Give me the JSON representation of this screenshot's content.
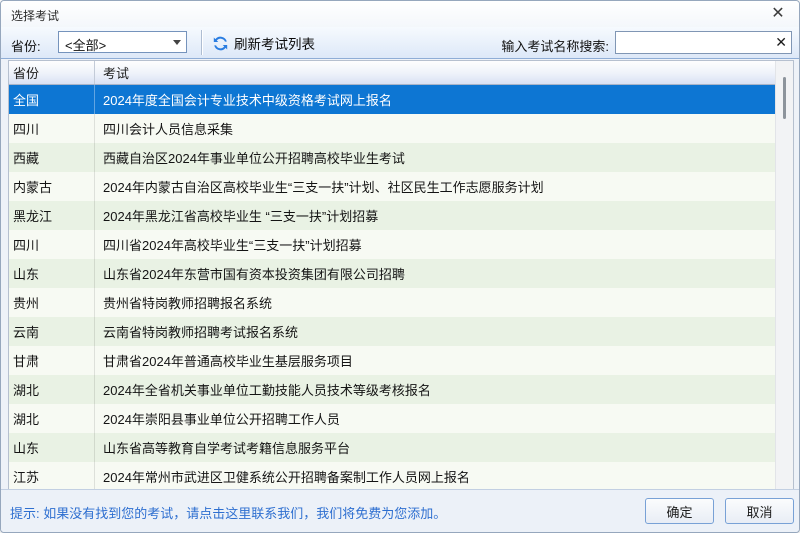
{
  "window": {
    "title": "选择考试",
    "close_glyph": "✕"
  },
  "toolbar": {
    "province_label": "省份:",
    "province_value": "<全部>",
    "refresh_label": "刷新考试列表",
    "search_label": "输入考试名称搜索:",
    "search_value": "",
    "clear_glyph": "✕"
  },
  "table": {
    "columns": [
      "省份",
      "考试"
    ],
    "rows": [
      {
        "province": "全国",
        "exam": "2024年度全国会计专业技术中级资格考试网上报名"
      },
      {
        "province": "四川",
        "exam": "四川会计人员信息采集"
      },
      {
        "province": "西藏",
        "exam": "西藏自治区2024年事业单位公开招聘高校毕业生考试"
      },
      {
        "province": "内蒙古",
        "exam": "2024年内蒙古自治区高校毕业生“三支一扶”计划、社区民生工作志愿服务计划"
      },
      {
        "province": "黑龙江",
        "exam": "2024年黑龙江省高校毕业生 “三支一扶”计划招募"
      },
      {
        "province": "四川",
        "exam": "四川省2024年高校毕业生“三支一扶”计划招募"
      },
      {
        "province": "山东",
        "exam": "山东省2024年东营市国有资本投资集团有限公司招聘"
      },
      {
        "province": "贵州",
        "exam": "贵州省特岗教师招聘报名系统"
      },
      {
        "province": "云南",
        "exam": "云南省特岗教师招聘考试报名系统"
      },
      {
        "province": "甘肃",
        "exam": "甘肃省2024年普通高校毕业生基层服务项目"
      },
      {
        "province": "湖北",
        "exam": "2024年全省机关事业单位工勤技能人员技术等级考核报名"
      },
      {
        "province": "湖北",
        "exam": "2024年崇阳县事业单位公开招聘工作人员"
      },
      {
        "province": "山东",
        "exam": "山东省高等教育自学考试考籍信息服务平台"
      },
      {
        "province": "江苏",
        "exam": "2024年常州市武进区卫健系统公开招聘备案制工作人员网上报名"
      }
    ]
  },
  "footer": {
    "hint": "提示: 如果没有找到您的考试，请点击这里联系我们，我们将免费为您添加。",
    "ok_label": "确定",
    "cancel_label": "取消"
  },
  "colors": {
    "selected_row": "#0d76d3",
    "alt_row": "#e9f2e4",
    "base_row": "#f7faf3",
    "accent_blue": "#2a7de1",
    "hint_link": "#2e6fd0"
  }
}
